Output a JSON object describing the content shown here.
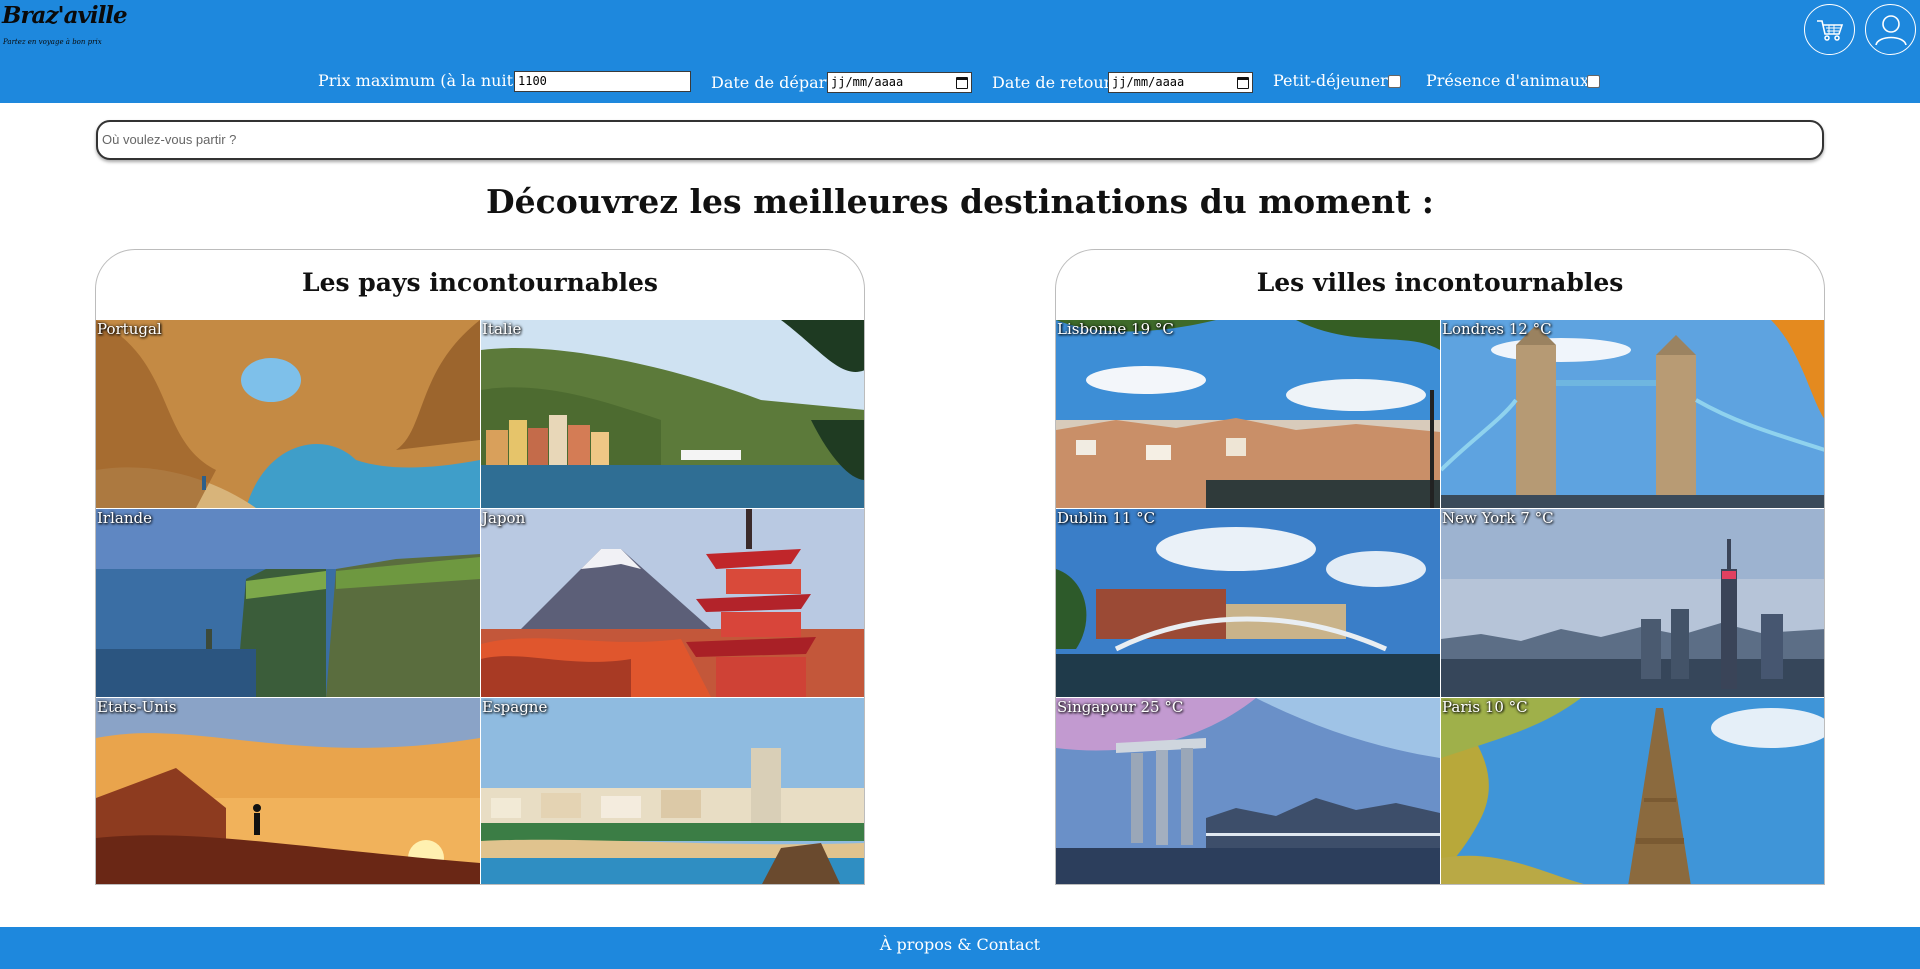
{
  "brand": {
    "name": "Braz'aville",
    "tagline": "Partez en voyage à bon prix"
  },
  "header": {
    "cart_icon": "cart-icon",
    "user_icon": "user-icon"
  },
  "filters": {
    "price_label": "Prix maximum (à la nuit)",
    "price_value": "1100",
    "departure_label": "Date de départ",
    "departure_placeholder": "jj/mm/aaaa",
    "return_label": "Date de retour",
    "return_placeholder": "jj/mm/aaaa",
    "breakfast_label": "Petit-déjeuner",
    "animals_label": "Présence d'animaux"
  },
  "search": {
    "placeholder": "Où voulez-vous partir ?"
  },
  "main_title": "Découvrez les meilleures destinations du moment :",
  "countries": {
    "title": "Les pays incontournables",
    "items": [
      {
        "label": "Portugal"
      },
      {
        "label": "Italie"
      },
      {
        "label": "Irlande"
      },
      {
        "label": "Japon"
      },
      {
        "label": "Etats-Unis"
      },
      {
        "label": "Espagne"
      }
    ]
  },
  "cities": {
    "title": "Les villes incontournables",
    "items": [
      {
        "label": "Lisbonne 19 °C"
      },
      {
        "label": "Londres 12 °C"
      },
      {
        "label": "Dublin 11 °C"
      },
      {
        "label": "New York 7 °C"
      },
      {
        "label": "Singapour 25 °C"
      },
      {
        "label": "Paris 10 °C"
      }
    ]
  },
  "footer": {
    "link": "À propos & Contact"
  },
  "colors": {
    "primary": "#1e88dd",
    "white": "#ffffff"
  }
}
